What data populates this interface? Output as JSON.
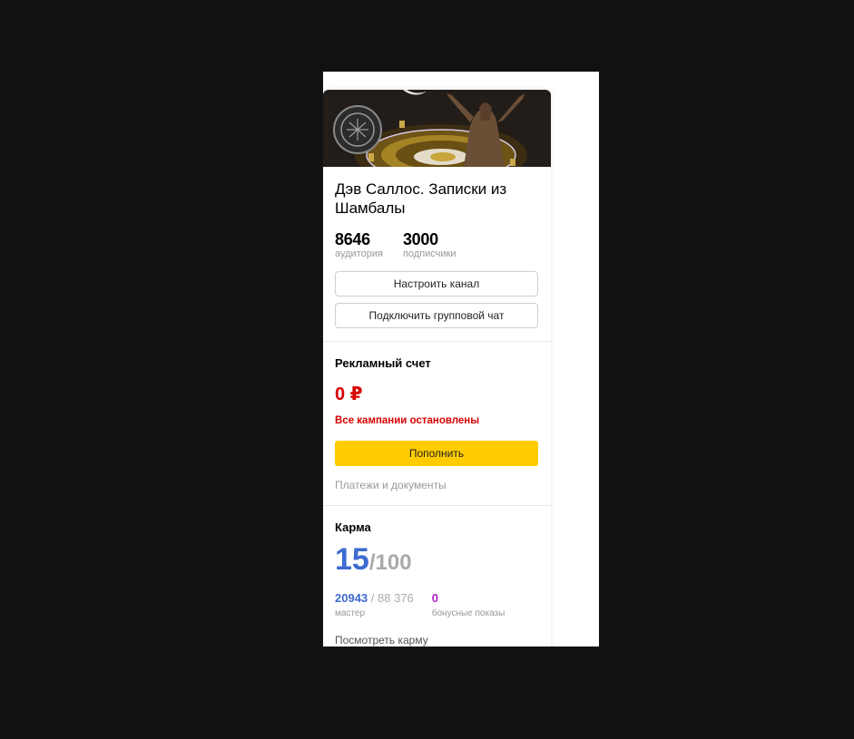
{
  "channel": {
    "title": "Дэв Саллос. Записки из Шамбалы",
    "stats": [
      {
        "value": "8646",
        "label": "аудитория"
      },
      {
        "value": "3000",
        "label": "подписчики"
      }
    ],
    "buttons": {
      "settings": "Настроить канал",
      "group_chat": "Подключить групповой чат"
    }
  },
  "ad_account": {
    "heading": "Рекламный счет",
    "balance": "0 ₽",
    "status": "Все кампании остановлены",
    "topup_button": "Пополнить",
    "payments_link": "Платежи и документы"
  },
  "karma": {
    "heading": "Карма",
    "value": "15",
    "max": "/100",
    "points": "20943",
    "points_total": " / 88 376",
    "points_label": "мастер",
    "bonus": "0",
    "bonus_label": "бонусные показы",
    "more_link": "Посмотреть карму"
  },
  "colors": {
    "accent_yellow": "#ffcc00",
    "alert_red": "#d80000",
    "karma_blue": "#3d6bd1",
    "bonus_purple": "#b21dc8"
  }
}
